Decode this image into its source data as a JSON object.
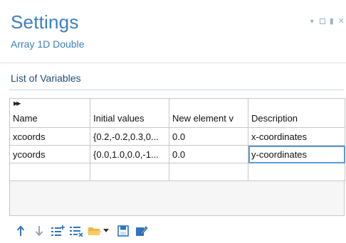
{
  "header": {
    "title": "Settings",
    "subtitle": "Array 1D Double"
  },
  "section": {
    "title": "List of Variables"
  },
  "table": {
    "columns": [
      "Name",
      "Initial values",
      "New element v",
      "Description"
    ],
    "rows": [
      [
        "xcoords",
        "{0.2,-0.2,0.3,0...",
        "0.0",
        "x-coordinates"
      ],
      [
        "ycoords",
        "{0.0,1.0,0.0,-1...",
        "0.0",
        "y-coordinates"
      ],
      [
        "",
        "",
        "",
        ""
      ]
    ]
  },
  "toolbar": {
    "icons": [
      "arrow-up-icon",
      "arrow-down-icon",
      "add-list-icon",
      "delete-list-icon",
      "open-folder-icon",
      "dropdown-chevron-icon",
      "save-icon",
      "edit-icon"
    ]
  },
  "colors": {
    "accent": "#3b7fc0",
    "section": "#1f4e79",
    "selection": "#5b9bd5"
  }
}
